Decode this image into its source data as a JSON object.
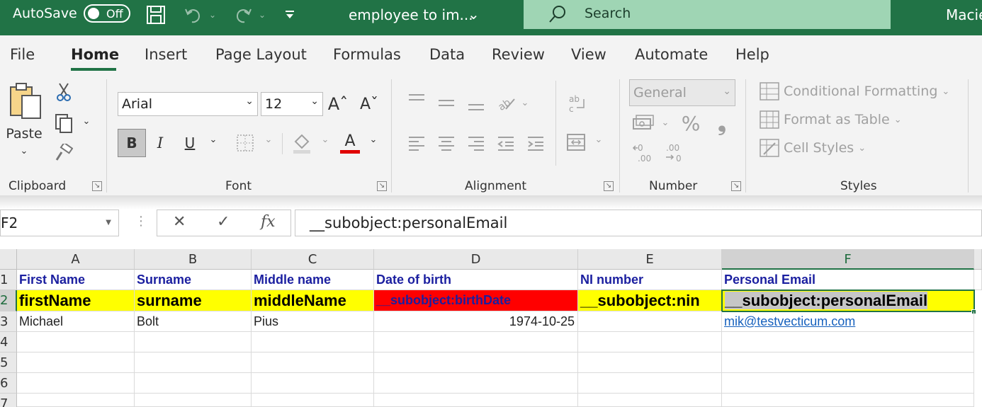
{
  "titlebar": {
    "autosave_label": "AutoSave",
    "autosave_state": "Off",
    "document_title": "employee to im...",
    "search_placeholder": "Search",
    "user_name": "Macie"
  },
  "ribbon": {
    "tabs": [
      "File",
      "Home",
      "Insert",
      "Page Layout",
      "Formulas",
      "Data",
      "Review",
      "View",
      "Automate",
      "Help"
    ],
    "active_tab": "Home",
    "clipboard": {
      "paste_label": "Paste",
      "group_label": "Clipboard"
    },
    "font": {
      "font_name": "Arial",
      "font_size": "12",
      "group_label": "Font"
    },
    "alignment": {
      "group_label": "Alignment"
    },
    "number": {
      "format": "General",
      "group_label": "Number"
    },
    "styles": {
      "conditional_formatting": "Conditional Formatting",
      "format_as_table": "Format as Table",
      "cell_styles": "Cell Styles",
      "group_label": "Styles"
    }
  },
  "formula_bar": {
    "name_box": "F2",
    "formula": "__subobject:personalEmail"
  },
  "grid": {
    "columns": [
      "A",
      "B",
      "C",
      "D",
      "E",
      "F"
    ],
    "rows": [
      "1",
      "2",
      "3",
      "4",
      "5",
      "6",
      "7"
    ],
    "selected_column": "F",
    "selected_row": "2",
    "row1": [
      "First Name",
      "Surname",
      "Middle name",
      "Date of birth",
      "NI number",
      "Personal Email"
    ],
    "row2": [
      "firstName",
      "surname",
      "middleName",
      "__subobject:birthDate",
      "__subobject:nin",
      "__subobject:personalEmail"
    ],
    "row3": [
      "Michael",
      "Bolt",
      "Pius",
      "1974-10-25",
      "",
      "mik@testvecticum.com"
    ]
  },
  "colors": {
    "accent": "#217346",
    "highlight_yellow": "#ffff00",
    "highlight_red": "#ff0000",
    "header_text_blue": "#1b1fa0"
  }
}
